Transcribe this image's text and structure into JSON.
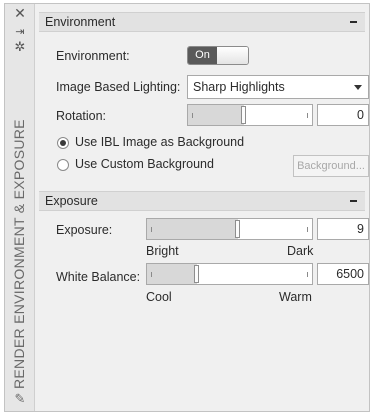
{
  "sidebar": {
    "close_icon": "close-icon",
    "pin_icon": "pin-icon",
    "settings_icon": "gear-icon",
    "title": "RENDER ENVIRONMENT & EXPOSURE",
    "bottom_icon": "panel-properties-icon"
  },
  "environment": {
    "header": "Environment",
    "env_label": "Environment:",
    "toggle_on": "On",
    "ibl_label": "Image Based Lighting:",
    "ibl_value": "Sharp Highlights",
    "rotation_label": "Rotation:",
    "rotation_value": "0",
    "rotation_fraction": 0.45,
    "radio_ibl_label": "Use IBL Image as Background",
    "radio_custom_label": "Use Custom Background",
    "background_button": "Background...",
    "selected_background": "ibl"
  },
  "exposure": {
    "header": "Exposure",
    "exposure_label": "Exposure:",
    "exposure_value": "9",
    "exposure_fraction": 0.55,
    "exposure_min_label": "Bright",
    "exposure_max_label": "Dark",
    "wb_label": "White Balance:",
    "wb_value": "6500",
    "wb_fraction": 0.3,
    "wb_min_label": "Cool",
    "wb_max_label": "Warm"
  }
}
